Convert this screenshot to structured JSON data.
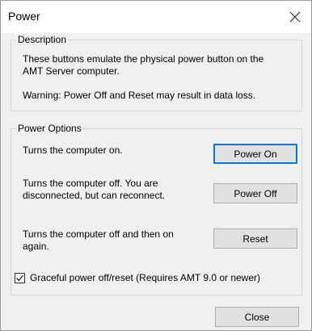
{
  "window": {
    "title": "Power"
  },
  "description": {
    "legend": "Description",
    "line1": "These buttons emulate the physical power button on the",
    "line2": "AMT Server computer.",
    "warning": "Warning: Power Off and Reset may result in data loss."
  },
  "power_options": {
    "legend": "Power Options",
    "rows": [
      {
        "text_line1": "Turns the computer on.",
        "text_line2": "",
        "button": "Power On"
      },
      {
        "text_line1": "Turns the computer off. You are",
        "text_line2": "disconnected, but can reconnect.",
        "button": "Power Off"
      },
      {
        "text_line1": "Turns the computer off and then on",
        "text_line2": "again.",
        "button": "Reset"
      }
    ],
    "graceful_checkbox": {
      "label": "Graceful power off/reset (Requires AMT 9.0 or newer)",
      "checked": true
    }
  },
  "footer": {
    "close_label": "Close"
  }
}
